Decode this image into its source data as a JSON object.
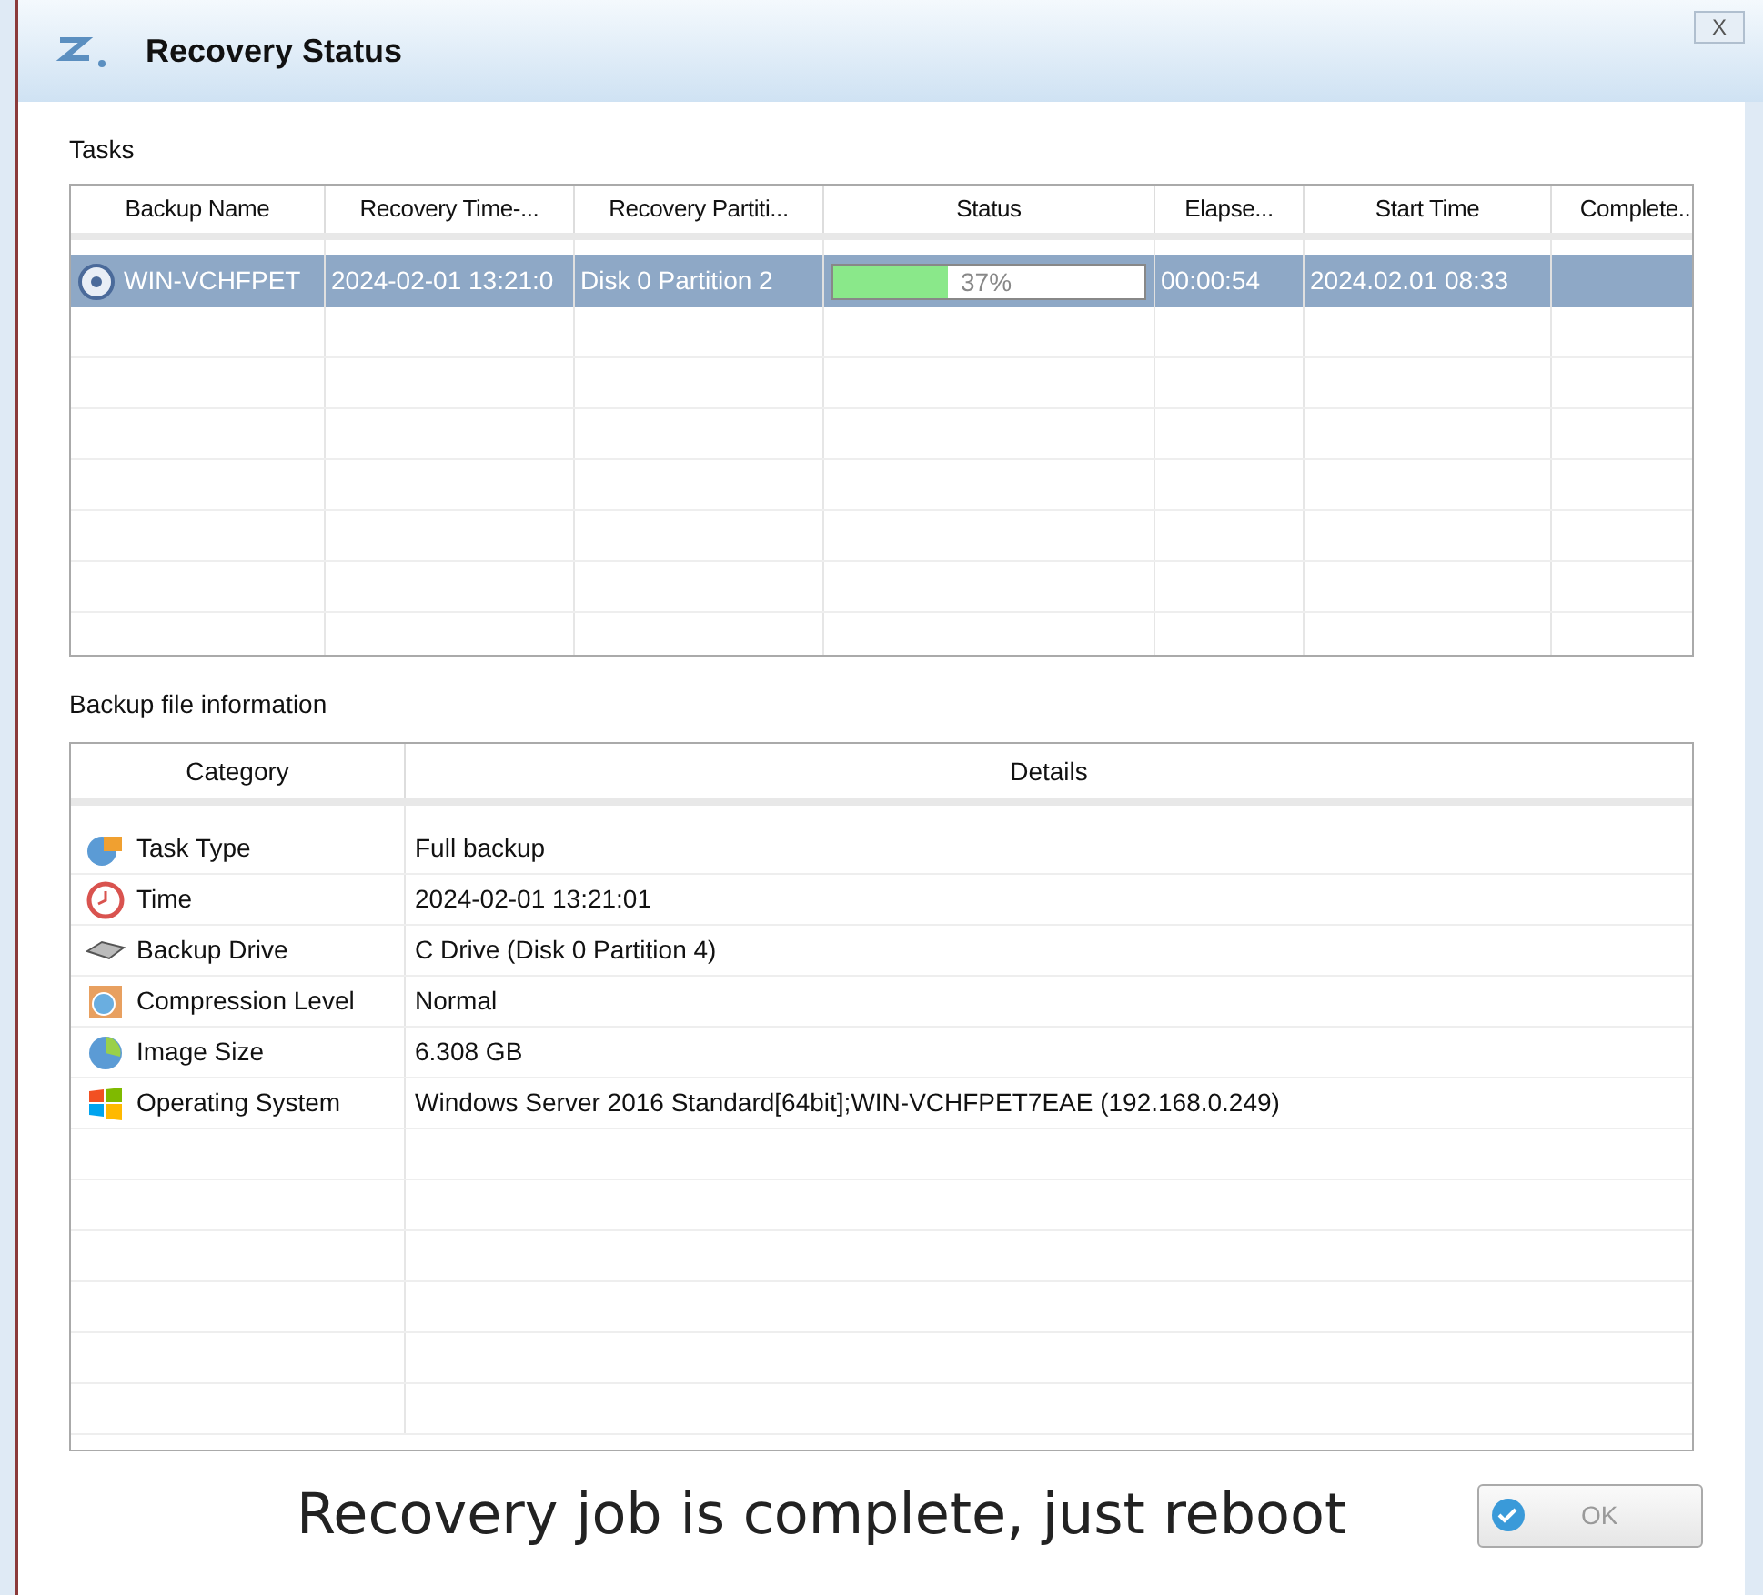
{
  "window": {
    "title": "Recovery Status",
    "close": "X"
  },
  "tasks": {
    "label": "Tasks",
    "columns": [
      "Backup Name",
      "Recovery Time-...",
      "Recovery Partiti...",
      "Status",
      "Elapse...",
      "Start Time",
      "Complete..."
    ],
    "rows": [
      {
        "selected": true,
        "backup_name": "WIN-VCHFPET",
        "recovery_time": "2024-02-01 13:21:0",
        "recovery_partition": "Disk 0 Partition 2",
        "status": {
          "level": 0.37,
          "text": "37%"
        },
        "elapsed": "00:00:54",
        "start_time": "2024.02.01 08:33",
        "complete": ""
      }
    ]
  },
  "backup_info": {
    "label": "Backup file information",
    "columns": [
      "Category",
      "Details"
    ],
    "rows": [
      {
        "kind": "task",
        "category": "Task Type",
        "details": "Full backup"
      },
      {
        "kind": "time",
        "category": "Time",
        "details": "2024-02-01 13:21:01"
      },
      {
        "kind": "drive",
        "category": "Backup Drive",
        "details": "C Drive (Disk 0 Partition 4)"
      },
      {
        "kind": "compression",
        "category": "Compression Level",
        "details": "Normal"
      },
      {
        "kind": "size",
        "category": "Image Size",
        "details": "6.308 GB"
      },
      {
        "kind": "os",
        "category": "Operating System",
        "details": "Windows Server 2016 Standard[64bit];WIN-VCHFPET7EAE (192.168.0.249)"
      }
    ]
  },
  "message": "Recovery job is complete, just reboot",
  "ok_button": {
    "label": "OK",
    "disabled": true
  }
}
